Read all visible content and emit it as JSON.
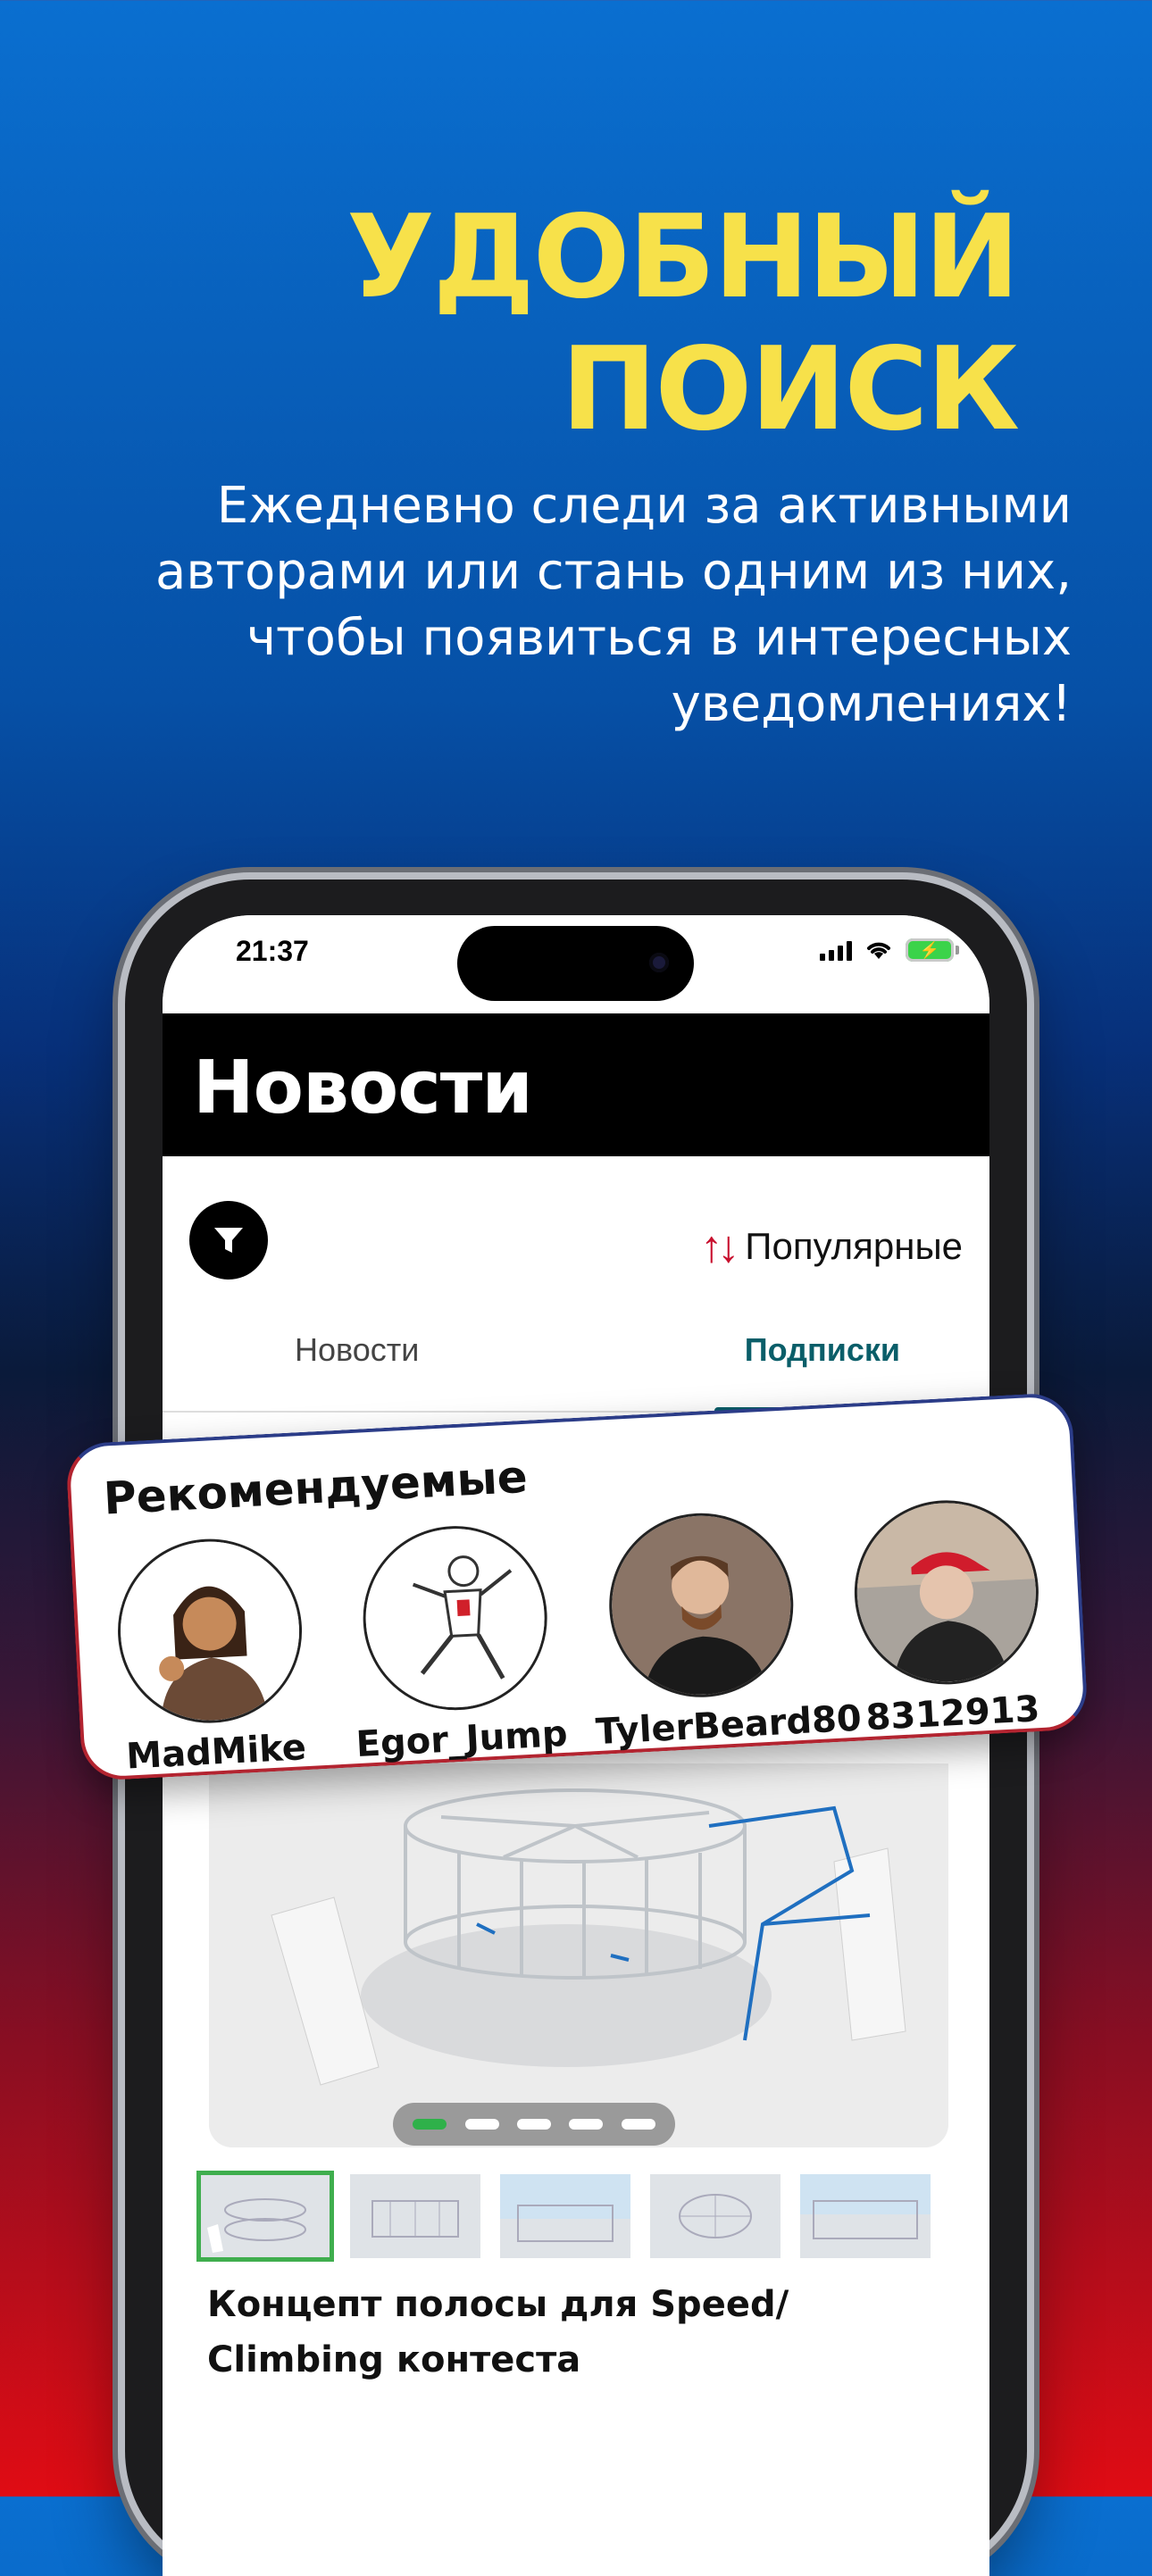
{
  "promo": {
    "headline_line1": "УДОБНЫЙ",
    "headline_line2": "ПОИСК",
    "subtitle_line1": "Ежедневно следи за активными",
    "subtitle_line2": "авторами или стань одним из них,",
    "subtitle_line3": "чтобы появиться в интересных",
    "subtitle_line4": "уведомлениях!",
    "headline_color": "#f7e14a"
  },
  "status_bar": {
    "time": "21:37",
    "icons": [
      "signal-icon",
      "wifi-icon",
      "battery-charging-icon"
    ]
  },
  "app": {
    "title": "Новости",
    "filter_icon": "filter-icon",
    "sort": {
      "icon": "sort-arrows-icon",
      "label": "Популярные"
    },
    "tabs": [
      {
        "label": "Новости",
        "active": false
      },
      {
        "label": "Подписки",
        "active": true
      }
    ],
    "accent_color": "#0a5e69"
  },
  "recommended": {
    "title": "Рекомендуемые",
    "users": [
      {
        "name": "MadMike",
        "avatar": "avatar-warrior"
      },
      {
        "name": "Egor_Jump",
        "avatar": "avatar-jumper-sketch"
      },
      {
        "name": "TylerBeard80",
        "avatar": "avatar-bearded-man"
      },
      {
        "name": "8312913",
        "avatar": "avatar-red-cap-man"
      }
    ]
  },
  "post": {
    "carousel_dots": 5,
    "active_dot": 0,
    "thumbnails": 5,
    "active_thumbnail": 0,
    "title_line1": "Концепт полосы для Speed/",
    "title_line2": "Climbing контеста"
  }
}
